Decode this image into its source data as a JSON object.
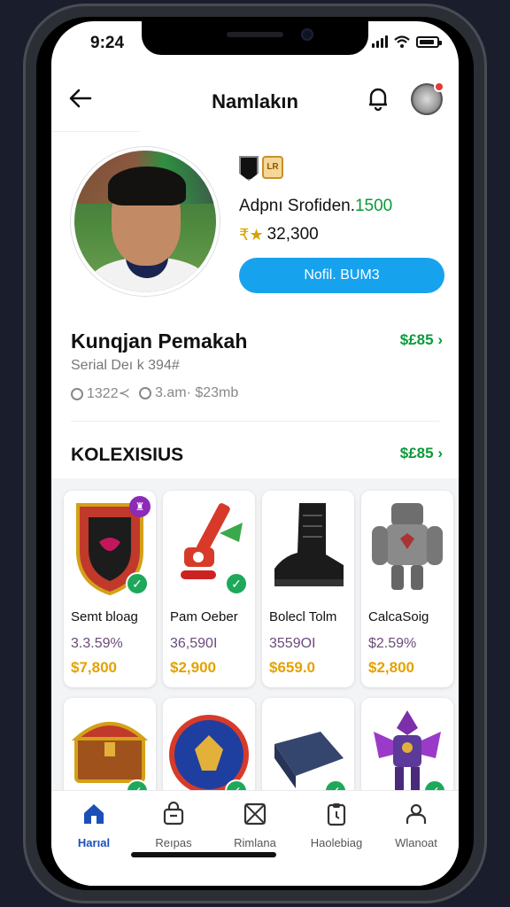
{
  "status": {
    "time": "9:24"
  },
  "appbar": {
    "title": "Namlakın"
  },
  "profile": {
    "player_line_prefix": "Adpnı Srofiden.",
    "player_line_accent": "1500",
    "coins": "32,300",
    "primary_button": "Nofil. BUM3"
  },
  "section1": {
    "title": "Kunqjan Pemakah",
    "link": "$£85",
    "subtitle": "Serial Deı k 394#",
    "stat1": "1322≺",
    "stat2": "3.am· $23mb"
  },
  "section2": {
    "title": "KOLEXISIUS",
    "link": "$£85"
  },
  "items": [
    {
      "name": "Semt bloag",
      "pct": "3.3.59%",
      "price": "$7,800",
      "icon": "shield-item-icon"
    },
    {
      "name": "Pam Oeber",
      "pct": "36,590I",
      "price": "$2,900",
      "icon": "lanyard-item-icon"
    },
    {
      "name": "Bolecl Tolm",
      "pct": "3559OI",
      "price": "$659.0",
      "icon": "boot-item-icon"
    },
    {
      "name": "CalcaSoig",
      "pct": "$2.59%",
      "price": "$2,800",
      "icon": "armor-item-icon"
    },
    {
      "name": "",
      "pct": "",
      "price": "",
      "icon": "chest-item-icon"
    },
    {
      "name": "",
      "pct": "",
      "price": "",
      "icon": "emblem-item-icon"
    },
    {
      "name": "",
      "pct": "",
      "price": "",
      "icon": "cloth-item-icon"
    },
    {
      "name": "",
      "pct": "",
      "price": "",
      "icon": "mech-item-icon"
    }
  ],
  "nav": [
    {
      "label": "Harıal",
      "icon": "home-icon",
      "active": true
    },
    {
      "label": "Reıpas",
      "icon": "bag-icon",
      "active": false
    },
    {
      "label": "Rimlana",
      "icon": "box-icon",
      "active": false
    },
    {
      "label": "Haolebiag",
      "icon": "clipboard-icon",
      "active": false
    },
    {
      "label": "Wlanoat",
      "icon": "profile-icon",
      "active": false
    }
  ],
  "colors": {
    "accent": "#17a2ee",
    "green": "#0a9a3a",
    "gold": "#e3a200",
    "nav_active": "#1b4fb8"
  }
}
